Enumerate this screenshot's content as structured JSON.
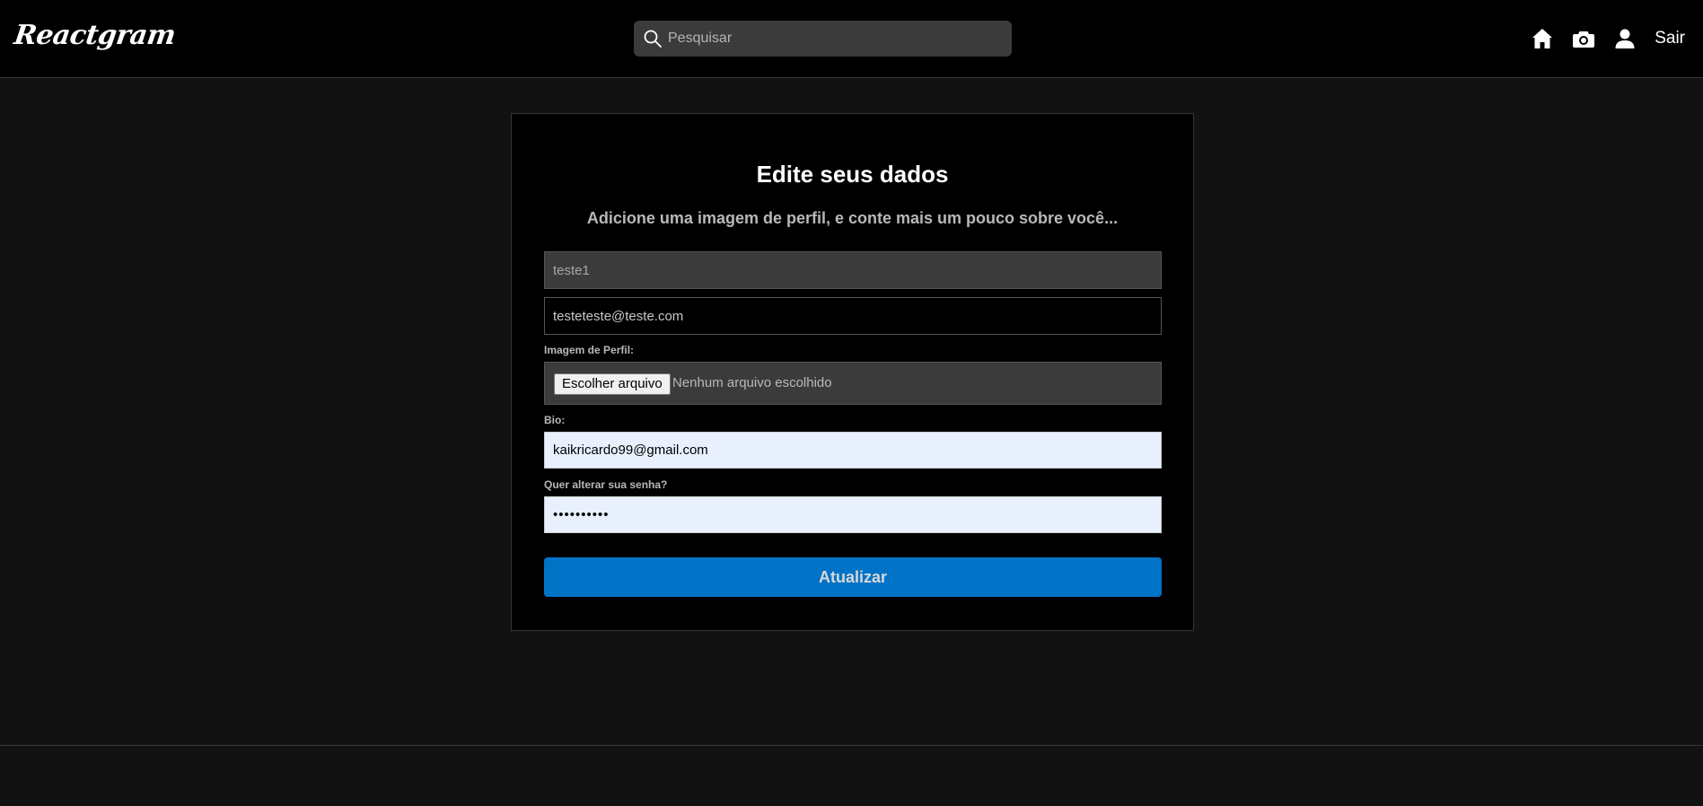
{
  "navbar": {
    "logo": "Reactgram",
    "search": {
      "placeholder": "Pesquisar",
      "value": "",
      "icon": "search-icon"
    },
    "links": [
      {
        "icon": "home-icon"
      },
      {
        "icon": "camera-icon"
      },
      {
        "icon": "user-icon"
      },
      {
        "label": "Sair"
      }
    ]
  },
  "form": {
    "title": "Edite seus dados",
    "subtitle": "Adicione uma imagem de perfil, e conte mais um pouco sobre você...",
    "name_value": "teste1",
    "email_value": "testeteste@teste.com",
    "image_label": "Imagem de Perfil:",
    "file_button_label": "Escolher arquivo",
    "file_status": "Nenhum arquivo escolhido",
    "bio_label": "Bio:",
    "bio_value": "kaikricardo99@gmail.com",
    "password_label": "Quer alterar sua senha?",
    "password_value": "••••••••••",
    "submit_label": "Atualizar"
  },
  "colors": {
    "page_bg": "#121212",
    "navbar_bg": "#000000",
    "card_bg": "#000000",
    "accent": "#0073c7",
    "autofill_bg": "#e8f0fe"
  }
}
